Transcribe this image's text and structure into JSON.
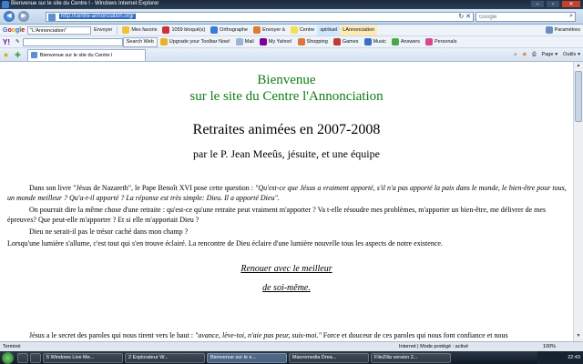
{
  "window": {
    "title": "Bienvenue sur le site du Centre l - Windows Internet Explorer",
    "buttons": [
      "–",
      "▫",
      "✕"
    ]
  },
  "addressbar": {
    "back_icon": "back-arrow-icon",
    "forward_icon": "forward-arrow-icon",
    "url": "http://centre-annonciation.org/",
    "search_placeholder": "Google"
  },
  "google_toolbar": {
    "logo": "Google",
    "query": "\"L'Annonciation\"",
    "send_label": "Envoyer",
    "favorites": "Mes favoris",
    "blocked": "1059 bloqué(s)",
    "spelling": "Orthographe",
    "send_to": "Envoyer à",
    "centre": "Centre",
    "spirituel": "spirituel",
    "annonciation": "LAnnonciation",
    "settings": "Paramètres"
  },
  "yahoo_toolbar": {
    "logo": "Y!",
    "search_web": "Search Web",
    "upgrade": "Upgrade your Toolbar Now!",
    "mail": "Mail",
    "my_yahoo": "My Yahoo!",
    "shopping": "Shopping",
    "games": "Games",
    "music": "Music",
    "answers": "Answers",
    "personals": "Personals"
  },
  "tabs_bar": {
    "tab_title": "Bienvenue sur le site du Centre l",
    "page_menu": "Page",
    "tools_menu": "Outils"
  },
  "page": {
    "welcome_line1": "Bienvenue",
    "welcome_line2": "sur le site du Centre l'Annonciation",
    "heading": "Retraites animées en 2007-2008",
    "subheading": "par le P. Jean Meeûs, jésuite, et une équipe",
    "p1_plain": "Dans son livre \"Jésus de Nazareth\", le Pape Benoît XVI pose cette question : ",
    "p1_italic": "\"Qu'est-ce que Jésus a vraiment apporté, s'il n'a pas apporté la paix dans le monde, le bien-être pour tous, un monde meilleur ? Qu'a-t-il apporté ? La réponse est très simple: Dieu. Il a apporté Dieu\".",
    "p2": "On pourrait dire la même chose d'une retraite : qu'est-ce qu'une retraite peut vraiment m'apporter ? Va t-elle résoudre mes problèmes, m'apporter un bien-être, me délivrer de mes épreuves? Que peut-elle m'apporter ? Et si elle m'apportait Dieu ?",
    "p3": "Dieu ne serait-il pas le trésor caché dans mon champ ?",
    "p4": "Lorsqu'une lumière s'allume, c'est tout qui s'en trouve éclairé. La rencontre de Dieu éclaire d'une lumière nouvelle tous les aspects de notre existence.",
    "link_line1": "Renouer avec le meilleur",
    "link_line2": "de soi-même.",
    "p5_plain": "Jésus a le secret des paroles qui nous tirent vers le haut : ",
    "p5_italic": "\"avance, lève-toi, n'aie pas peur, suis-moi.\"",
    "p5_rest": " Force et douceur de ces paroles qui nous font confiance et nous"
  },
  "statusbar": {
    "left": "Terminé",
    "zone": "Internet | Mode protégé : activé",
    "zoom": "100%"
  },
  "taskbar": {
    "buttons": [
      "5 Windows Live Me...",
      "2 Explorateur W...",
      "Bienvenue sur le s...",
      "Macromedia Drea...",
      "FileZilla version 2..."
    ],
    "active_index": 2,
    "clock": "22:43"
  }
}
